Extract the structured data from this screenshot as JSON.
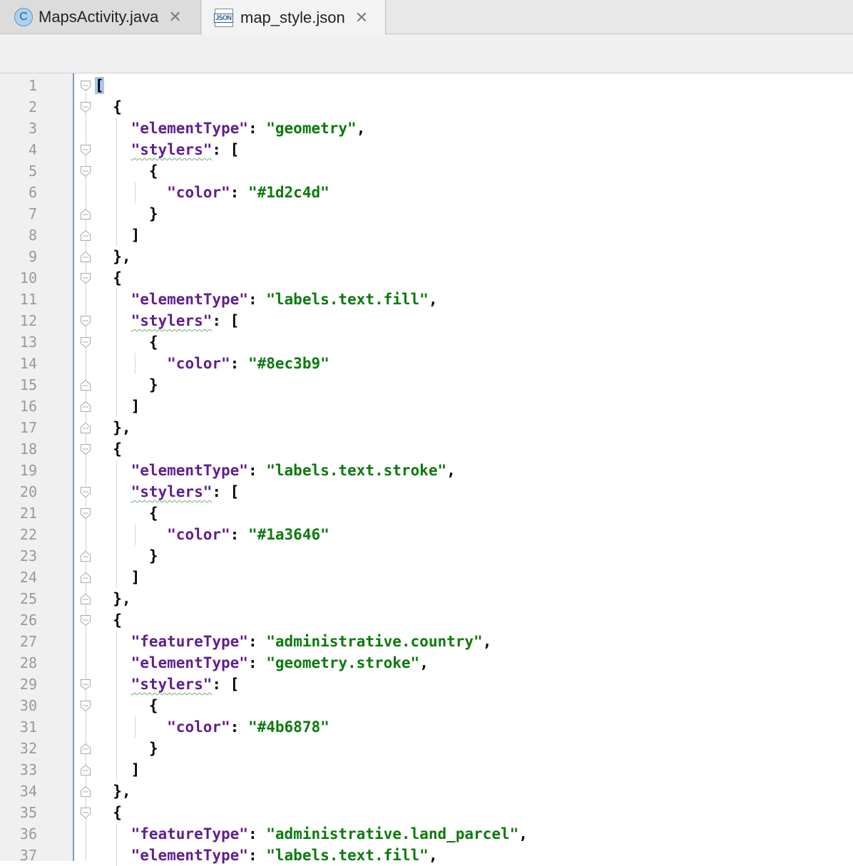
{
  "tabs": [
    {
      "label": "MapsActivity.java",
      "icon": "java-class-icon",
      "icon_glyph": "C",
      "active": false
    },
    {
      "label": "map_style.json",
      "icon": "json-file-icon",
      "icon_glyph": "JSON",
      "active": true
    }
  ],
  "close_glyph": "✕",
  "editor": {
    "lines": [
      {
        "n": "1",
        "fold": "open",
        "tokens": [
          {
            "t": "[",
            "c": "sel"
          }
        ]
      },
      {
        "n": "2",
        "fold": "open",
        "tokens": [
          {
            "t": "  {",
            "c": "p"
          }
        ]
      },
      {
        "n": "3",
        "fold": "",
        "tokens": [
          {
            "t": "    ",
            "c": "p"
          },
          {
            "t": "\"elementType\"",
            "c": "key"
          },
          {
            "t": ": ",
            "c": "p"
          },
          {
            "t": "\"geometry\"",
            "c": "str"
          },
          {
            "t": ",",
            "c": "p"
          }
        ]
      },
      {
        "n": "4",
        "fold": "open",
        "tokens": [
          {
            "t": "    ",
            "c": "p"
          },
          {
            "t": "\"stylers\"",
            "c": "key squig"
          },
          {
            "t": ": [",
            "c": "p"
          }
        ]
      },
      {
        "n": "5",
        "fold": "open",
        "tokens": [
          {
            "t": "      {",
            "c": "p"
          }
        ]
      },
      {
        "n": "6",
        "fold": "",
        "tokens": [
          {
            "t": "        ",
            "c": "p"
          },
          {
            "t": "\"color\"",
            "c": "key"
          },
          {
            "t": ": ",
            "c": "p"
          },
          {
            "t": "\"#1d2c4d\"",
            "c": "str"
          }
        ]
      },
      {
        "n": "7",
        "fold": "close",
        "tokens": [
          {
            "t": "      }",
            "c": "p"
          }
        ]
      },
      {
        "n": "8",
        "fold": "close",
        "tokens": [
          {
            "t": "    ]",
            "c": "p"
          }
        ]
      },
      {
        "n": "9",
        "fold": "close",
        "tokens": [
          {
            "t": "  },",
            "c": "p"
          }
        ]
      },
      {
        "n": "10",
        "fold": "open",
        "tokens": [
          {
            "t": "  {",
            "c": "p"
          }
        ]
      },
      {
        "n": "11",
        "fold": "",
        "tokens": [
          {
            "t": "    ",
            "c": "p"
          },
          {
            "t": "\"elementType\"",
            "c": "key"
          },
          {
            "t": ": ",
            "c": "p"
          },
          {
            "t": "\"labels.text.fill\"",
            "c": "str"
          },
          {
            "t": ",",
            "c": "p"
          }
        ]
      },
      {
        "n": "12",
        "fold": "open",
        "tokens": [
          {
            "t": "    ",
            "c": "p"
          },
          {
            "t": "\"stylers\"",
            "c": "key squig"
          },
          {
            "t": ": [",
            "c": "p"
          }
        ]
      },
      {
        "n": "13",
        "fold": "open",
        "tokens": [
          {
            "t": "      {",
            "c": "p"
          }
        ]
      },
      {
        "n": "14",
        "fold": "",
        "tokens": [
          {
            "t": "        ",
            "c": "p"
          },
          {
            "t": "\"color\"",
            "c": "key"
          },
          {
            "t": ": ",
            "c": "p"
          },
          {
            "t": "\"#8ec3b9\"",
            "c": "str"
          }
        ]
      },
      {
        "n": "15",
        "fold": "close",
        "tokens": [
          {
            "t": "      }",
            "c": "p"
          }
        ]
      },
      {
        "n": "16",
        "fold": "close",
        "tokens": [
          {
            "t": "    ]",
            "c": "p"
          }
        ]
      },
      {
        "n": "17",
        "fold": "close",
        "tokens": [
          {
            "t": "  },",
            "c": "p"
          }
        ]
      },
      {
        "n": "18",
        "fold": "open",
        "tokens": [
          {
            "t": "  {",
            "c": "p"
          }
        ]
      },
      {
        "n": "19",
        "fold": "",
        "tokens": [
          {
            "t": "    ",
            "c": "p"
          },
          {
            "t": "\"elementType\"",
            "c": "key"
          },
          {
            "t": ": ",
            "c": "p"
          },
          {
            "t": "\"labels.text.stroke\"",
            "c": "str"
          },
          {
            "t": ",",
            "c": "p"
          }
        ]
      },
      {
        "n": "20",
        "fold": "open",
        "tokens": [
          {
            "t": "    ",
            "c": "p"
          },
          {
            "t": "\"stylers\"",
            "c": "key squig"
          },
          {
            "t": ": [",
            "c": "p"
          }
        ]
      },
      {
        "n": "21",
        "fold": "open",
        "tokens": [
          {
            "t": "      {",
            "c": "p"
          }
        ]
      },
      {
        "n": "22",
        "fold": "",
        "tokens": [
          {
            "t": "        ",
            "c": "p"
          },
          {
            "t": "\"color\"",
            "c": "key"
          },
          {
            "t": ": ",
            "c": "p"
          },
          {
            "t": "\"#1a3646\"",
            "c": "str"
          }
        ]
      },
      {
        "n": "23",
        "fold": "close",
        "tokens": [
          {
            "t": "      }",
            "c": "p"
          }
        ]
      },
      {
        "n": "24",
        "fold": "close",
        "tokens": [
          {
            "t": "    ]",
            "c": "p"
          }
        ]
      },
      {
        "n": "25",
        "fold": "close",
        "tokens": [
          {
            "t": "  },",
            "c": "p"
          }
        ]
      },
      {
        "n": "26",
        "fold": "open",
        "tokens": [
          {
            "t": "  {",
            "c": "p"
          }
        ]
      },
      {
        "n": "27",
        "fold": "",
        "tokens": [
          {
            "t": "    ",
            "c": "p"
          },
          {
            "t": "\"featureType\"",
            "c": "key"
          },
          {
            "t": ": ",
            "c": "p"
          },
          {
            "t": "\"administrative.country\"",
            "c": "str"
          },
          {
            "t": ",",
            "c": "p"
          }
        ]
      },
      {
        "n": "28",
        "fold": "",
        "tokens": [
          {
            "t": "    ",
            "c": "p"
          },
          {
            "t": "\"elementType\"",
            "c": "key"
          },
          {
            "t": ": ",
            "c": "p"
          },
          {
            "t": "\"geometry.stroke\"",
            "c": "str"
          },
          {
            "t": ",",
            "c": "p"
          }
        ]
      },
      {
        "n": "29",
        "fold": "open",
        "tokens": [
          {
            "t": "    ",
            "c": "p"
          },
          {
            "t": "\"stylers\"",
            "c": "key squig"
          },
          {
            "t": ": [",
            "c": "p"
          }
        ]
      },
      {
        "n": "30",
        "fold": "open",
        "tokens": [
          {
            "t": "      {",
            "c": "p"
          }
        ]
      },
      {
        "n": "31",
        "fold": "",
        "tokens": [
          {
            "t": "        ",
            "c": "p"
          },
          {
            "t": "\"color\"",
            "c": "key"
          },
          {
            "t": ": ",
            "c": "p"
          },
          {
            "t": "\"#4b6878\"",
            "c": "str"
          }
        ]
      },
      {
        "n": "32",
        "fold": "close",
        "tokens": [
          {
            "t": "      }",
            "c": "p"
          }
        ]
      },
      {
        "n": "33",
        "fold": "close",
        "tokens": [
          {
            "t": "    ]",
            "c": "p"
          }
        ]
      },
      {
        "n": "34",
        "fold": "close",
        "tokens": [
          {
            "t": "  },",
            "c": "p"
          }
        ]
      },
      {
        "n": "35",
        "fold": "open",
        "tokens": [
          {
            "t": "  {",
            "c": "p"
          }
        ]
      },
      {
        "n": "36",
        "fold": "",
        "tokens": [
          {
            "t": "    ",
            "c": "p"
          },
          {
            "t": "\"featureType\"",
            "c": "key"
          },
          {
            "t": ": ",
            "c": "p"
          },
          {
            "t": "\"administrative.land_parcel\"",
            "c": "str"
          },
          {
            "t": ",",
            "c": "p"
          }
        ]
      },
      {
        "n": "37",
        "fold": "",
        "tokens": [
          {
            "t": "    ",
            "c": "p"
          },
          {
            "t": "\"elementType\"",
            "c": "key"
          },
          {
            "t": ": ",
            "c": "p"
          },
          {
            "t": "\"labels.text.fill\"",
            "c": "str"
          },
          {
            "t": ",",
            "c": "p"
          }
        ]
      }
    ]
  },
  "colors": {
    "key": "#5f1f8e",
    "string": "#0c7a0c",
    "line_number": "#999999",
    "gutter_border": "#7d99c1",
    "selection": "#a8c7f0"
  }
}
